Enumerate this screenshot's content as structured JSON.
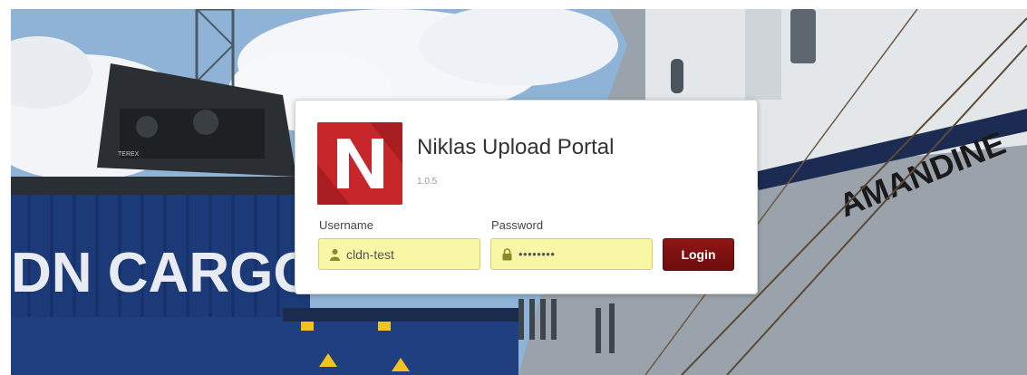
{
  "app": {
    "title": "Niklas Upload Portal",
    "version": "1.0.5",
    "logo_letter": "N",
    "brand_color": "#c7262b"
  },
  "form": {
    "username_label": "Username",
    "username_value": "cldn-test",
    "password_label": "Password",
    "password_value": "••••••••",
    "login_label": "Login",
    "autofill_color": "#f7f7a6",
    "button_color": "#7a1010"
  },
  "background": {
    "container_text": "DN CARGO",
    "ship_name": "AMANDINE",
    "crane_brand": "TEREX"
  },
  "icons": {
    "username": "user-icon",
    "password": "lock-icon"
  }
}
